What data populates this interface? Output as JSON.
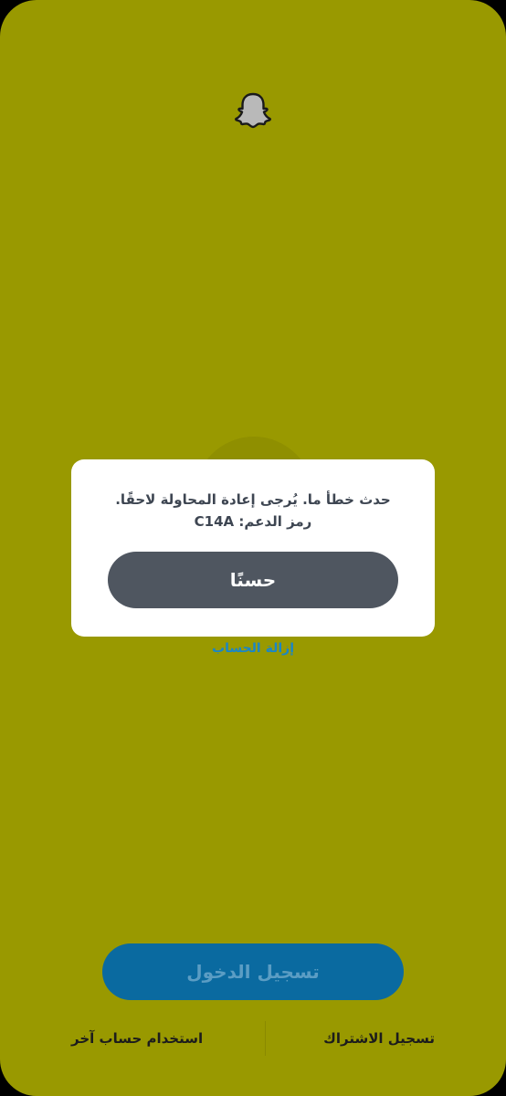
{
  "dialog": {
    "message_line1": "حدث خطأ ما. يُرجى إعادة المحاولة لاحقًا.",
    "message_line2": "رمز الدعم: C14A",
    "ok_label": "حسنًا"
  },
  "remove_account_label": "إزالة الحساب",
  "login_label": "تسجيل الدخول",
  "bottom": {
    "signup_label": "تسجيل الاشتراك",
    "other_account_label": "استخدام حساب آخر"
  },
  "colors": {
    "background": "#999900",
    "dialog_button": "#4f5660",
    "login_button": "#0a6aa0",
    "link": "#1a86c7"
  },
  "icons": {
    "logo": "snapchat-ghost-icon"
  }
}
